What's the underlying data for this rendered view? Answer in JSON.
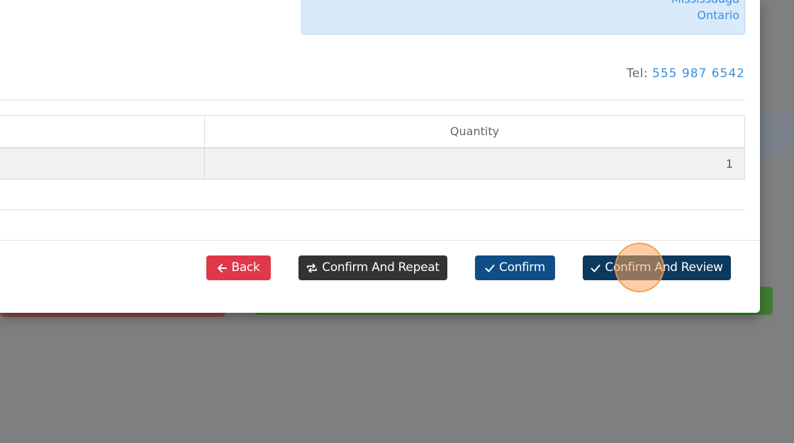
{
  "address": {
    "city": "Mississauga",
    "province": "Ontario"
  },
  "contact": {
    "tel_label": "Tel:",
    "tel_value": "555 987 6542"
  },
  "table": {
    "headers": [
      "",
      "Quantity"
    ],
    "rows": [
      {
        "col_a": "",
        "quantity": "1"
      }
    ]
  },
  "actions": {
    "back_label": "Back",
    "repeat_label": "Confirm And Repeat",
    "confirm_label": "Confirm",
    "review_label": "Confirm And Review"
  },
  "colors": {
    "back": "#e0384a",
    "repeat": "#333333",
    "confirm": "#0f4f86",
    "review": "#0c3a5e",
    "link": "#3a8fdc",
    "click_marker": "#f7a65e"
  },
  "icons": {
    "back": "arrow-left-icon",
    "repeat": "repeat-icon",
    "confirm": "check-icon",
    "review": "check-icon"
  }
}
